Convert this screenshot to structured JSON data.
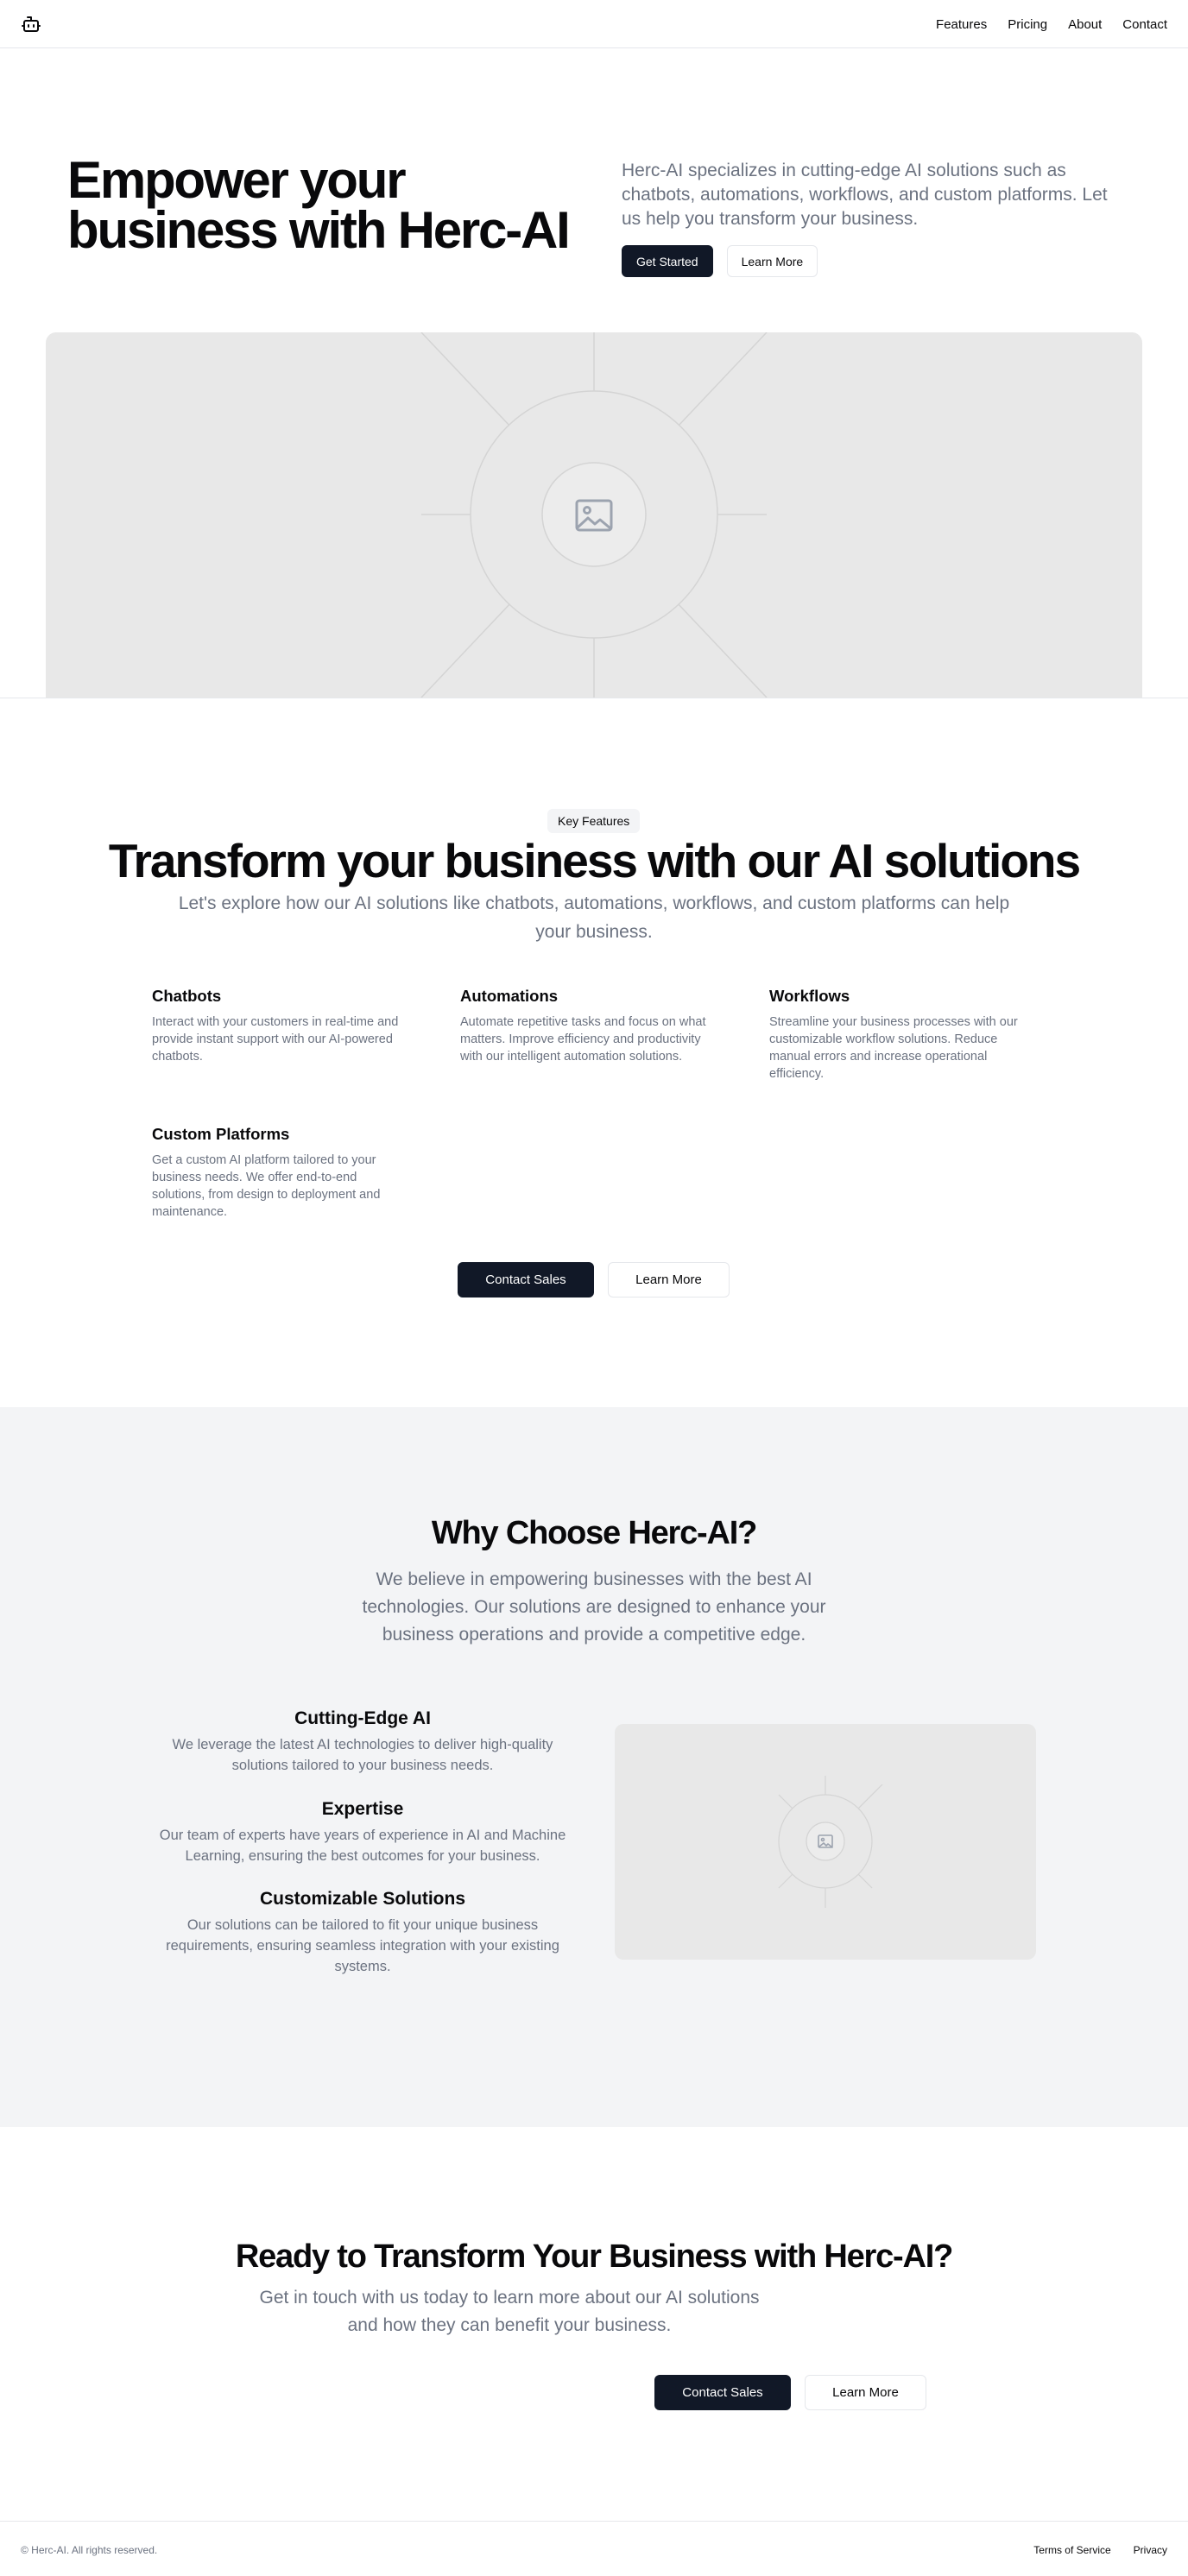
{
  "header": {
    "logo_icon": "bot-icon",
    "nav": [
      "Features",
      "Pricing",
      "About",
      "Contact"
    ]
  },
  "hero": {
    "title": "Empower your business with Herc-AI",
    "description": "Herc-AI specializes in cutting-edge AI solutions such as chatbots, automations, workflows, and custom platforms. Let us help you transform your business.",
    "primary_button": "Get Started",
    "secondary_button": "Learn More",
    "image_icon": "image-placeholder-icon"
  },
  "features": {
    "badge": "Key Features",
    "title": "Transform your business with our AI solutions",
    "subtitle": "Let's explore how our AI solutions like chatbots, automations, workflows, and custom platforms can help your business.",
    "items": [
      {
        "title": "Chatbots",
        "description": "Interact with your customers in real-time and provide instant support with our AI-powered chatbots."
      },
      {
        "title": "Automations",
        "description": "Automate repetitive tasks and focus on what matters. Improve efficiency and productivity with our intelligent automation solutions."
      },
      {
        "title": "Workflows",
        "description": "Streamline your business processes with our customizable workflow solutions. Reduce manual errors and increase operational efficiency."
      },
      {
        "title": "Custom Platforms",
        "description": "Get a custom AI platform tailored to your business needs. We offer end-to-end solutions, from design to deployment and maintenance."
      }
    ],
    "primary_button": "Contact Sales",
    "secondary_button": "Learn More"
  },
  "why": {
    "title": "Why Choose Herc-AI?",
    "subtitle": "We believe in empowering businesses with the best AI technologies. Our solutions are designed to enhance your business operations and provide a competitive edge.",
    "items": [
      {
        "title": "Cutting-Edge AI",
        "description": "We leverage the latest AI technologies to deliver high-quality solutions tailored to your business needs."
      },
      {
        "title": "Expertise",
        "description": "Our team of experts have years of experience in AI and Machine Learning, ensuring the best outcomes for your business."
      },
      {
        "title": "Customizable Solutions",
        "description": "Our solutions can be tailored to fit your unique business requirements, ensuring seamless integration with your existing systems."
      }
    ]
  },
  "cta": {
    "title": "Ready to Transform Your Business with Herc-AI?",
    "subtitle": "Get in touch with us today to learn more about our AI solutions and how they can benefit your business.",
    "primary_button": "Contact Sales",
    "secondary_button": "Learn More"
  },
  "footer": {
    "copyright": "© Herc-AI. All rights reserved.",
    "links": [
      "Terms of Service",
      "Privacy"
    ]
  },
  "colors": {
    "primary": "#111827",
    "muted_text": "#6b7280",
    "section_bg": "#f3f4f6",
    "placeholder_bg": "#e8e8e8"
  }
}
